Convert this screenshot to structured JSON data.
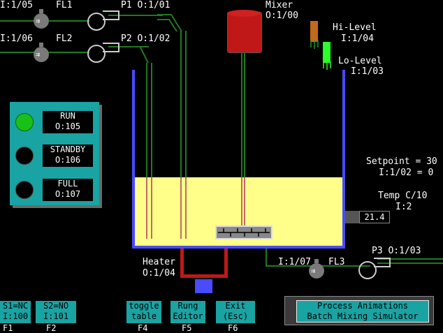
{
  "inputs": {
    "fl1_addr": "I:1/05",
    "fl1_name": "FL1",
    "fl2_addr": "I:1/06",
    "fl2_name": "FL2",
    "fl3_addr": "I:1/07",
    "fl3_name": "FL3",
    "p1": "P1 O:1/01",
    "p2": "P2 O:1/02",
    "p3": "P3 O:1/03"
  },
  "mixer": {
    "label": "Mixer",
    "addr": "O:1/00"
  },
  "levels": {
    "hi_label": "Hi-Level",
    "hi_addr": "I:1/04",
    "lo_label": "Lo-Level",
    "lo_addr": "I:1/03"
  },
  "status": {
    "run_label": "RUN",
    "run_addr": "O:105",
    "standby_label": "STANDBY",
    "standby_addr": "O:106",
    "full_label": "FULL",
    "full_addr": "O:107"
  },
  "setpoint": {
    "line1": "Setpoint = 30",
    "line2": "I:1/02 = 0"
  },
  "temp": {
    "label": "Temp C/10",
    "addr": "I:2",
    "value": "21.4"
  },
  "heater": {
    "label": "Heater",
    "addr": "O:1/04"
  },
  "buttons": {
    "s1_l1": "S1=NC",
    "s1_l2": "I:100",
    "s1_f": "F1",
    "s2_l1": "S2=NO",
    "s2_l2": "I:101",
    "s2_f": "F2",
    "toggle_l1": "toggle",
    "toggle_l2": "table",
    "toggle_f": "F4",
    "rung_l1": "Rung",
    "rung_l2": "Editor",
    "rung_f": "F5",
    "exit_l1": "Exit",
    "exit_l2": "(Esc)",
    "exit_f": "F6"
  },
  "title": {
    "line1": "Process Animations",
    "line2": "Batch Mixing Simulator"
  },
  "colors": {
    "pipe": "#1f7a1f",
    "tank_wall": "#4a4aff",
    "liquid": "#ffff8a",
    "panel": "#19a3a3",
    "run_on": "#19c019",
    "heater": "#c01818"
  }
}
